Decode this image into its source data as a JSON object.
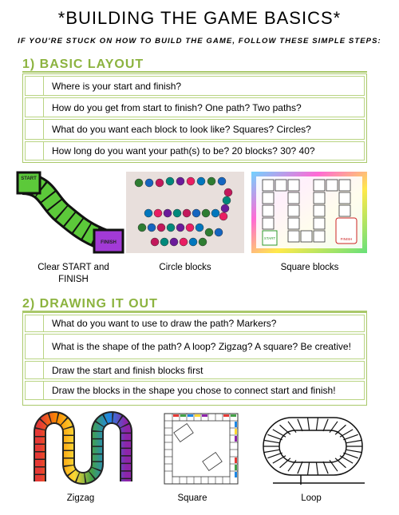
{
  "title": "*BUILDING THE GAME BASICS*",
  "subtitle": "IF YOU'RE STUCK ON HOW TO BUILD THE GAME, FOLLOW THESE SIMPLE STEPS:",
  "section1": {
    "heading": "1) BASIC LAYOUT",
    "items": [
      "Where is your start and finish?",
      "How do you get from start to finish? One path? Two paths?",
      "What do you want each block to look like? Squares? Circles?",
      "How long do you want your path(s) to be? 20 blocks? 30? 40?"
    ],
    "captions": [
      "Clear START and\nFINISH",
      "Circle blocks",
      "Square blocks"
    ],
    "image_text": {
      "start": "START",
      "finish": "FINISH"
    }
  },
  "section2": {
    "heading": "2) DRAWING IT OUT",
    "items": [
      "What do you want to use to draw the path? Markers?",
      "What is the shape of the path? A loop? Zigzag? A square? Be creative!",
      "Draw the start and finish blocks first",
      "Draw the blocks in the shape you chose to connect start and finish!"
    ],
    "captions": [
      "Zigzag",
      "Square",
      "Loop"
    ]
  },
  "colors": {
    "accent_green": "#8cb33f",
    "border_green": "#a9c86a",
    "path_green": "#5cc93a"
  }
}
